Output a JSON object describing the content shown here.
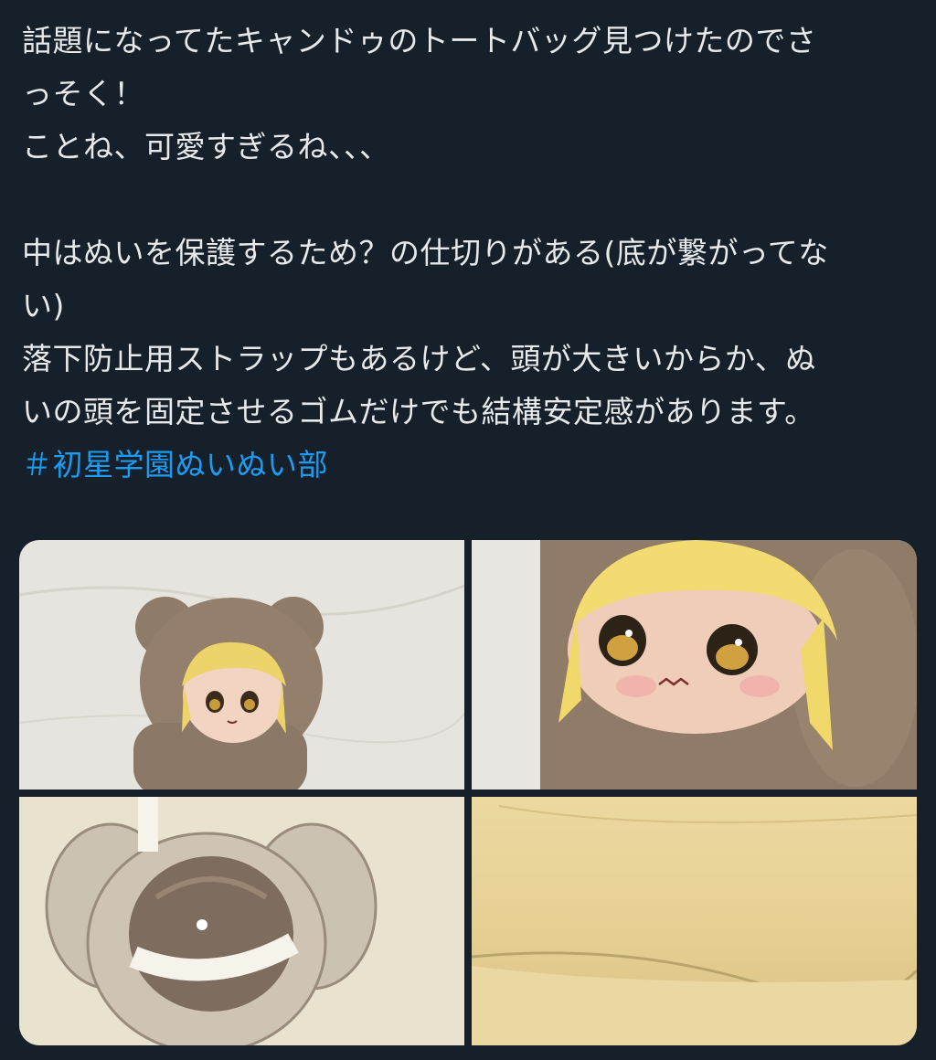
{
  "tweet": {
    "lines": [
      "話題になってたキャンドゥのトートバッグ見つけたのでさ",
      "っそく！",
      "ことね、可愛すぎるね、、、",
      "",
      "中はぬいを保護するため？の仕切りがある(底が繋がってな",
      "い)",
      "落下防止用ストラップもあるけど、頭が大きいからか、ぬ",
      "いの頭を固定させるゴムだけでも結構安定感があります。"
    ],
    "hashtag": "＃初星学園ぬいぬい部"
  },
  "media": {
    "photos": [
      {
        "subject": "plush in bear hood pocket on tote bag"
      },
      {
        "subject": "close-up of plush face with blonde hair"
      },
      {
        "subject": "plush back of head held by elastic band"
      },
      {
        "subject": "inside of tote bag cream fabric"
      }
    ]
  },
  "colors": {
    "background": "#15202b",
    "text": "#e7e9ea",
    "hashtag": "#1d9bf0"
  }
}
